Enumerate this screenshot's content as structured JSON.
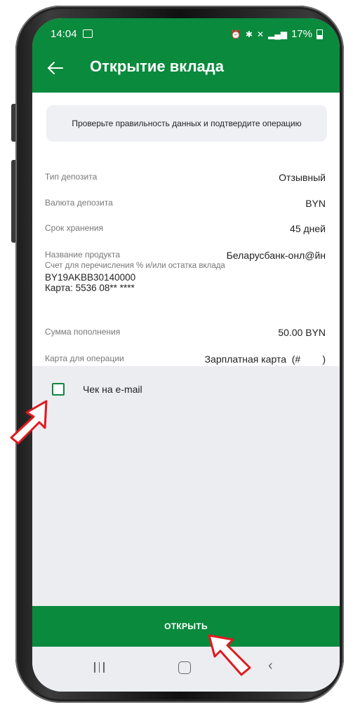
{
  "status": {
    "time": "14:04",
    "battery": "17%",
    "icons": [
      "alarm-icon",
      "bluetooth-icon",
      "mute-icon",
      "4g-icon",
      "signal-icon",
      "battery-icon"
    ]
  },
  "header": {
    "title": "Открытие вклада"
  },
  "notice": "Проверьте правильность данных и подтвердите операцию",
  "details": {
    "deposit_type_label": "Тип депозита",
    "deposit_type_value": "Отзывный",
    "currency_label": "Валюта депозита",
    "currency_value": "BYN",
    "term_label": "Срок хранения",
    "term_value": "45 дней",
    "product_label": "Название продукта",
    "product_value": "Беларусбанк-онл@йн",
    "account_label": "Счет для перечисления % и/или остатка вклада",
    "account_number": "BY19AKBB30140000",
    "account_card": "Карта: 5536 08** ****",
    "amount_label": "Сумма пополнения",
    "amount_value": "50.00 BYN",
    "card_label": "Карта для операции",
    "card_value": "Зарплатная карта  (#        )"
  },
  "email_check": {
    "label": "Чек на e-mail",
    "checked": false
  },
  "actions": {
    "open_label": "ОТКРЫТЬ"
  },
  "colors": {
    "brand_green": "#0a8a3c",
    "arrow_red": "#e0191f"
  }
}
